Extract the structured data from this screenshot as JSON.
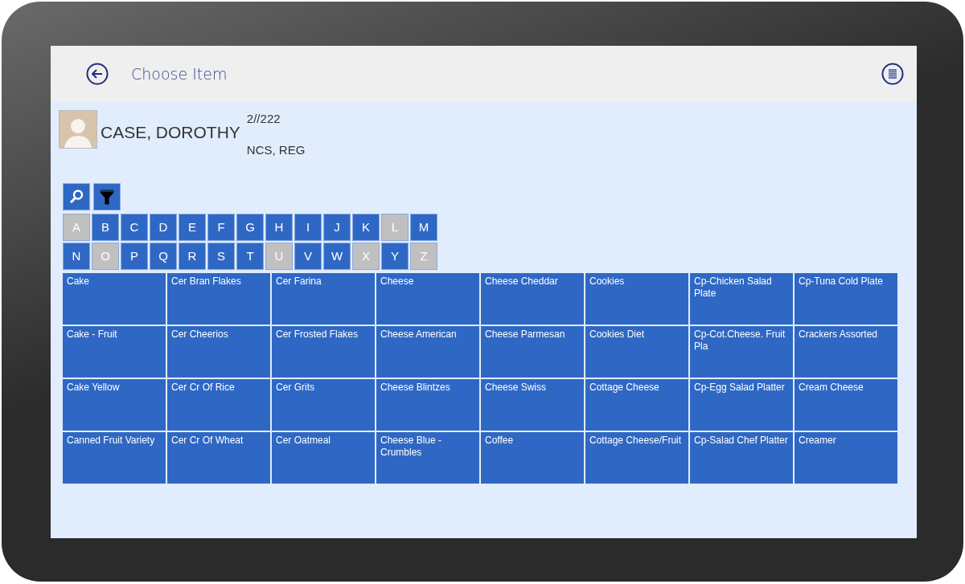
{
  "header": {
    "title": "Choose Item"
  },
  "patient": {
    "name": "CASE, DOROTHY",
    "room": "2//222",
    "diet": "NCS, REG"
  },
  "letters": [
    {
      "label": "A",
      "disabled": true
    },
    {
      "label": "B",
      "disabled": false
    },
    {
      "label": "C",
      "disabled": false
    },
    {
      "label": "D",
      "disabled": false
    },
    {
      "label": "E",
      "disabled": false
    },
    {
      "label": "F",
      "disabled": false
    },
    {
      "label": "G",
      "disabled": false
    },
    {
      "label": "H",
      "disabled": false
    },
    {
      "label": "I",
      "disabled": false
    },
    {
      "label": "J",
      "disabled": false
    },
    {
      "label": "K",
      "disabled": false
    },
    {
      "label": "L",
      "disabled": true
    },
    {
      "label": "M",
      "disabled": false
    },
    {
      "label": "N",
      "disabled": false
    },
    {
      "label": "O",
      "disabled": true
    },
    {
      "label": "P",
      "disabled": false
    },
    {
      "label": "Q",
      "disabled": false
    },
    {
      "label": "R",
      "disabled": false
    },
    {
      "label": "S",
      "disabled": false
    },
    {
      "label": "T",
      "disabled": false
    },
    {
      "label": "U",
      "disabled": true
    },
    {
      "label": "V",
      "disabled": false
    },
    {
      "label": "W",
      "disabled": false
    },
    {
      "label": "X",
      "disabled": true
    },
    {
      "label": "Y",
      "disabled": false
    },
    {
      "label": "Z",
      "disabled": true
    }
  ],
  "items": [
    "Cake",
    "Cake - Fruit",
    "Cake Yellow",
    "Canned Fruit Variety",
    "Cer Bran Flakes",
    "Cer Cheerios",
    "Cer Cr Of Rice",
    "Cer Cr Of Wheat",
    "Cer Farina",
    "Cer Frosted Flakes",
    "Cer Grits",
    "Cer Oatmeal",
    "Cheese",
    "Cheese American",
    "Cheese Blintzes",
    "Cheese Blue - Crumbles",
    "Cheese Cheddar",
    "Cheese Parmesan",
    "Cheese Swiss",
    "Coffee",
    "Cookies",
    "Cookies Diet",
    "Cottage Cheese",
    "Cottage Cheese/Fruit",
    "Cp-Chicken Salad Plate",
    "Cp-Cot.Cheese. Fruit Pla",
    "Cp-Egg Salad Platter",
    "Cp-Salad Chef Platter",
    "Cp-Tuna Cold Plate",
    "Crackers Assorted",
    "Cream Cheese",
    "Creamer"
  ]
}
